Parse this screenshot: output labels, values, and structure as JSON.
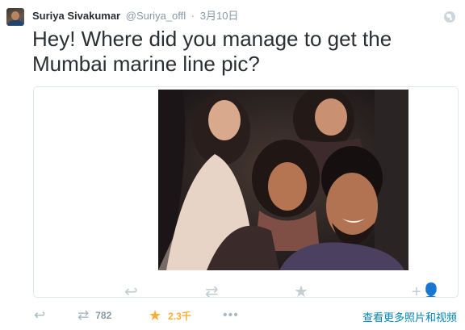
{
  "author": {
    "fullname": "Suriya Sivakumar",
    "username": "@Suriya_offl",
    "separator": "·",
    "timestamp": "3月10日"
  },
  "tweet": {
    "text": "Hey! Where did you manage to get the Mumbai marine line pic?"
  },
  "media_ghost_icons": {
    "reply": "↩",
    "retweet": "⇄",
    "favorite": "★",
    "follow": "+👤"
  },
  "actions": {
    "reply_icon": "↩",
    "retweet_icon": "⇄",
    "retweet_count": "782",
    "favorite_icon": "★",
    "favorite_count": "2.3千",
    "more_icon": "•••",
    "view_more_label": "查看更多照片和视频"
  },
  "colors": {
    "link": "#0084b4",
    "favorite": "#ffac33",
    "muted": "#8899a6",
    "text": "#292f33"
  },
  "icons": [
    "globe-icon",
    "reply-icon",
    "retweet-icon",
    "star-icon",
    "more-icon"
  ]
}
